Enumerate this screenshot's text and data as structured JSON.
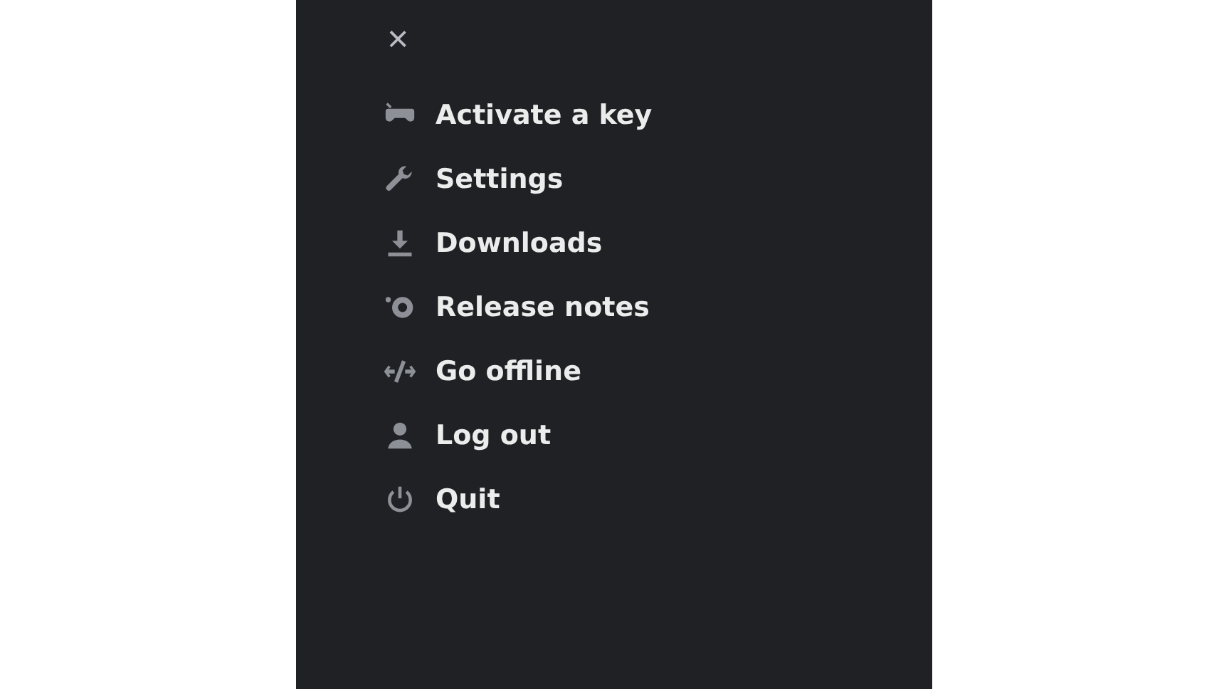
{
  "close_button": "×",
  "menu": [
    {
      "kind": "gamepad",
      "label": "Activate a key"
    },
    {
      "kind": "wrench",
      "label": "Settings"
    },
    {
      "kind": "download",
      "label": "Downloads"
    },
    {
      "kind": "notes",
      "label": "Release notes"
    },
    {
      "kind": "offline",
      "label": "Go offline"
    },
    {
      "kind": "user",
      "label": "Log out"
    },
    {
      "kind": "power",
      "label": "Quit"
    }
  ]
}
